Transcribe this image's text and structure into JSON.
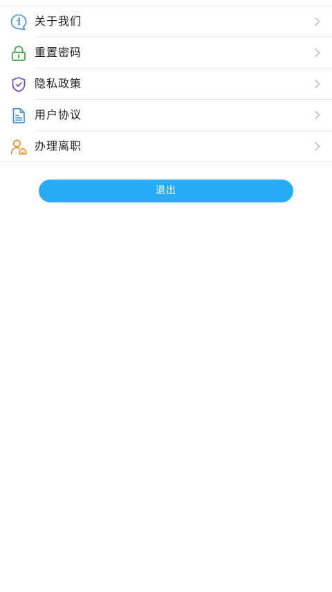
{
  "menu": {
    "items": [
      {
        "label": "关于我们",
        "icon": "info-icon",
        "color": "#3d8fe0"
      },
      {
        "label": "重置密码",
        "icon": "lock-icon",
        "color": "#3ea845"
      },
      {
        "label": "隐私政策",
        "icon": "shield-icon",
        "color": "#6a3fd6"
      },
      {
        "label": "用户协议",
        "icon": "document-icon",
        "color": "#3d8fe0"
      },
      {
        "label": "办理离职",
        "icon": "user-resign-icon",
        "color": "#f08a2c"
      }
    ],
    "chevron_icon": "chevron-right-icon"
  },
  "logout": {
    "label": "退出",
    "color": "#27acf5"
  }
}
